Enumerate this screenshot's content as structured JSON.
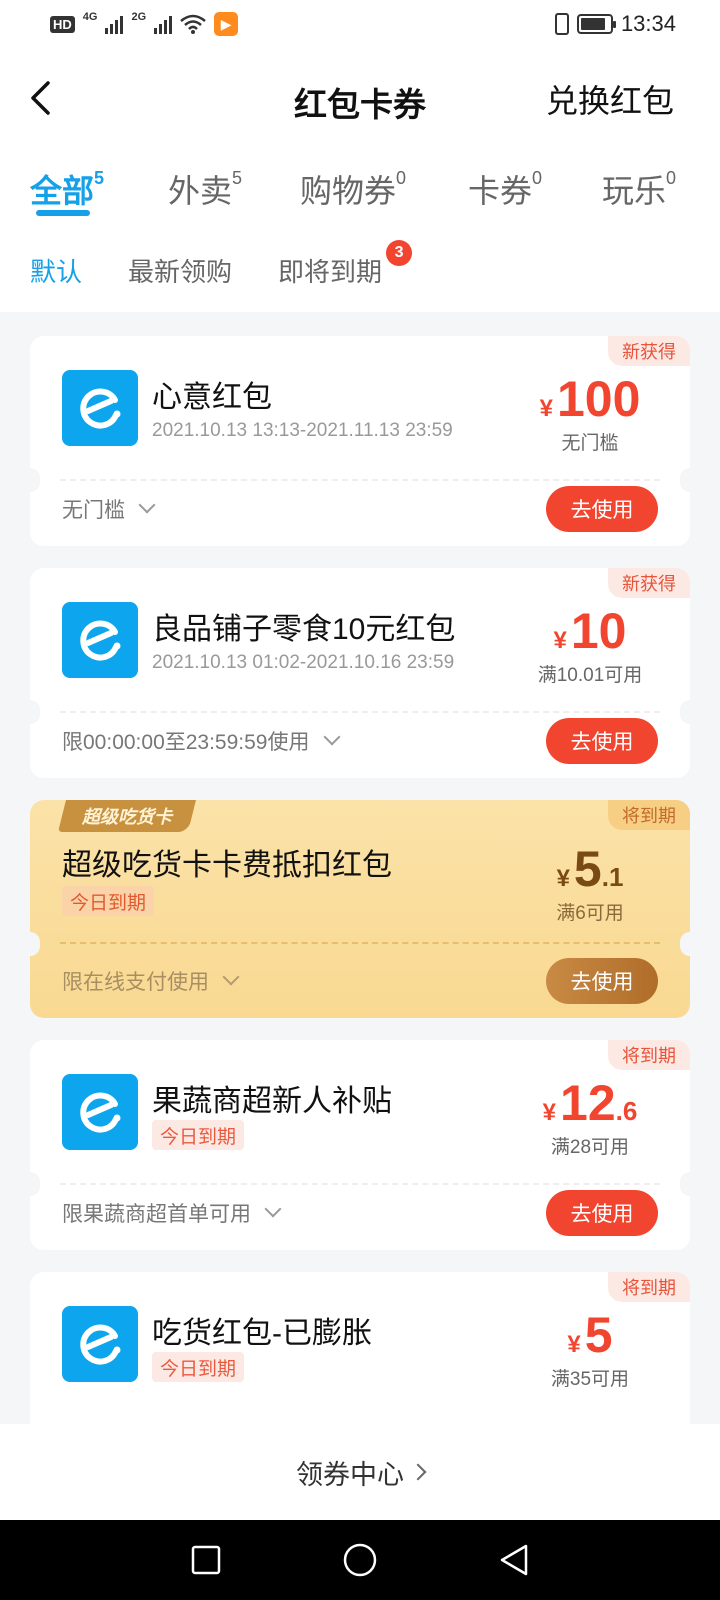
{
  "status_bar": {
    "hd": "HD",
    "net1": "4G",
    "net2": "2G",
    "time": "13:34",
    "battery_level": 0.85
  },
  "header": {
    "title": "红包卡券",
    "exchange": "兑换红包"
  },
  "tabs": [
    {
      "label": "全部",
      "count": "5"
    },
    {
      "label": "外卖",
      "count": "5"
    },
    {
      "label": "购物券",
      "count": "0"
    },
    {
      "label": "卡券",
      "count": "0"
    },
    {
      "label": "玩乐",
      "count": "0"
    }
  ],
  "sort": {
    "default": "默认",
    "newest": "最新领购",
    "expiring": "即将到期",
    "expiring_badge": "3"
  },
  "cards": [
    {
      "corner": "新获得",
      "name": "心意红包",
      "date": "2021.10.13 13:13-2021.11.13 23:59",
      "currency": "¥",
      "int": "100",
      "dec": "",
      "cond": "无门槛",
      "foot": "无门槛",
      "btn": "去使用"
    },
    {
      "corner": "新获得",
      "name": "良品铺子零食10元红包",
      "date": "2021.10.13 01:02-2021.10.16 23:59",
      "currency": "¥",
      "int": "10",
      "dec": "",
      "cond": "满10.01可用",
      "foot": "限00:00:00至23:59:59使用",
      "btn": "去使用"
    },
    {
      "corner": "将到期",
      "badge": "超级吃货卡",
      "name": "超级吃货卡卡费抵扣红包",
      "expire": "今日到期",
      "currency": "¥",
      "int": "5",
      "dec": ".1",
      "cond": "满6可用",
      "foot": "限在线支付使用",
      "btn": "去使用"
    },
    {
      "corner": "将到期",
      "name": "果蔬商超新人补贴",
      "expire": "今日到期",
      "currency": "¥",
      "int": "12",
      "dec": ".6",
      "cond": "满28可用",
      "foot": "限果蔬商超首单可用",
      "btn": "去使用"
    },
    {
      "corner": "将到期",
      "name": "吃货红包-已膨胀",
      "expire": "今日到期",
      "currency": "¥",
      "int": "5",
      "dec": "",
      "cond": "满35可用"
    }
  ],
  "bottom": {
    "label": "领券中心"
  },
  "colors": {
    "accent": "#14a1e8",
    "red": "#f2452f",
    "gold": "#f9d992"
  }
}
